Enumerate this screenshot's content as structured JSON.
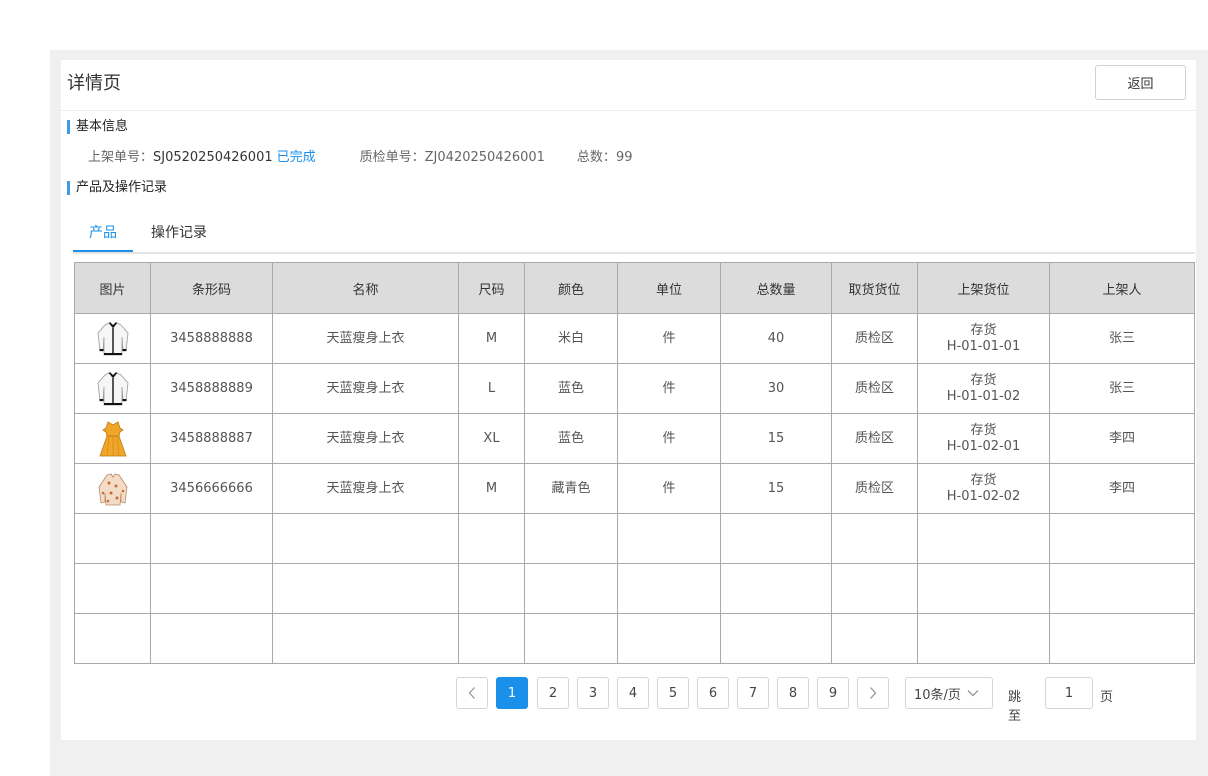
{
  "header": {
    "title": "详情页",
    "back_label": "返回"
  },
  "basic_info": {
    "section_title": "基本信息",
    "putaway_label": "上架单号：",
    "putaway_no": "SJ0520250426001",
    "status": "已完成",
    "qc_label": "质检单号：",
    "qc_no": "ZJ0420250426001",
    "total_label": "总数：",
    "total": "99"
  },
  "records": {
    "section_title": "产品及操作记录",
    "tabs": [
      {
        "label": "产品"
      },
      {
        "label": "操作记录"
      }
    ],
    "active_tab": 0
  },
  "table": {
    "columns": [
      "图片",
      "条形码",
      "名称",
      "尺码",
      "颜色",
      "单位",
      "总数量",
      "取货货位",
      "上架货位",
      "上架人"
    ],
    "rows": [
      {
        "image": "white-cardigan-icon",
        "barcode": "3458888888",
        "name": "天蓝瘦身上衣",
        "size": "M",
        "color": "米白",
        "unit": "件",
        "qty": "40",
        "pick_loc": "质检区",
        "shelf_loc_line1": "存货",
        "shelf_loc_line2": "H-01-01-01",
        "operator": "张三"
      },
      {
        "image": "white-cardigan-icon",
        "barcode": "3458888889",
        "name": "天蓝瘦身上衣",
        "size": "L",
        "color": "蓝色",
        "unit": "件",
        "qty": "30",
        "pick_loc": "质检区",
        "shelf_loc_line1": "存货",
        "shelf_loc_line2": "H-01-01-02",
        "operator": "张三"
      },
      {
        "image": "orange-dress-icon",
        "barcode": "3458888887",
        "name": "天蓝瘦身上衣",
        "size": "XL",
        "color": "蓝色",
        "unit": "件",
        "qty": "15",
        "pick_loc": "质检区",
        "shelf_loc_line1": "存货",
        "shelf_loc_line2": "H-01-02-01",
        "operator": "李四"
      },
      {
        "image": "floral-blouse-icon",
        "barcode": "3456666666",
        "name": "天蓝瘦身上衣",
        "size": "M",
        "color": "藏青色",
        "unit": "件",
        "qty": "15",
        "pick_loc": "质检区",
        "shelf_loc_line1": "存货",
        "shelf_loc_line2": "H-01-02-02",
        "operator": "李四"
      }
    ],
    "empty_rows": 3
  },
  "pagination": {
    "pages": [
      "1",
      "2",
      "3",
      "4",
      "5",
      "6",
      "7",
      "8",
      "9"
    ],
    "current": "1",
    "page_size": "10条/页",
    "jump_label": "跳至",
    "jump_value": "1",
    "jump_unit": "页"
  },
  "colors": {
    "accent": "#1a90ea",
    "header_bg": "#dcdcdc",
    "frame_bg": "#f0f0f0"
  }
}
